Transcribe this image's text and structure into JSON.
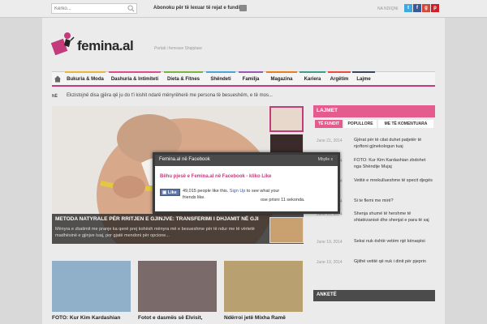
{
  "topbar": {
    "search_placeholder": "Kërko...",
    "subscribe_text": "Abonoku për të lexuar të rejat e fundit",
    "follow_label": "NA NDIQNI",
    "social": [
      {
        "name": "twitter-icon",
        "glyph": "t",
        "color": "#3fa9e0"
      },
      {
        "name": "facebook-icon",
        "glyph": "f",
        "color": "#3b5998"
      },
      {
        "name": "googleplus-icon",
        "glyph": "g",
        "color": "#d34836"
      },
      {
        "name": "pinterest-icon",
        "glyph": "p",
        "color": "#cb2027"
      }
    ]
  },
  "brand": {
    "logo": "femina.al",
    "tagline": "Portali i femrave Shqiptare",
    "accent": "#c43b7c"
  },
  "nav": {
    "items": [
      {
        "label": "Bukuria & Moda",
        "color": "#e8b63a"
      },
      {
        "label": "Dashuria & Intimiteti",
        "color": "#d94f8a"
      },
      {
        "label": "Dieta & Fitnes",
        "color": "#7bb43f"
      },
      {
        "label": "Shëndeti",
        "color": "#48a6d6"
      },
      {
        "label": "Familja",
        "color": "#9b59b6"
      },
      {
        "label": "Magazina",
        "color": "#e67e22"
      },
      {
        "label": "Kariera",
        "color": "#3b9c8f"
      },
      {
        "label": "Argëtim",
        "color": "#e74c3c"
      },
      {
        "label": "Lajme",
        "color": "#34495e"
      }
    ]
  },
  "ticker": {
    "label": "NË",
    "text": "Ekzistojnë disa gjëra që ju do t'i kishit ndarë mënyrëherë me persona të besueshëm, e të mos..."
  },
  "hero": {
    "title": "METODA NATYRALE PËR RRITJEN E GJINJVE: TRANSFERIMI I DHJAMIT NË GJI",
    "desc": "Mënyra e zbatimit me pranje ka qenë prej kohësh mënyra më e besueshme për të ndur me të vërtetë madhësinë e gjinjve tuaj, por gjatë mendoni për opcione..."
  },
  "cards": [
    {
      "title": "FOTO: Kur Kim Kardashian"
    },
    {
      "title": "Fotot e dasmës së Elvisit,"
    },
    {
      "title": "Ndërroi jetë Mixha Ramë"
    }
  ],
  "sidebar": {
    "header": "LAJMET",
    "tabs": [
      "TË FUNDIT",
      "POPULLORE",
      "ME TË KOMENTUARA"
    ],
    "news": [
      {
        "date": "June 21, 2014",
        "title": "Gjërat për të cilat duhet patjetër të njoftoni gjinekologun tuaj"
      },
      {
        "date": "June 21, 2014",
        "title": "FOTO: Kur Kim Kardashian zbdohet nga Shëndije Mujaj"
      },
      {
        "date": "June 20, 2014",
        "title": "Vetitë e mrekullueshme të specit djegës"
      },
      {
        "date": "June 20, 2014",
        "title": "Si te flemi me mirë?"
      },
      {
        "date": "June 20, 2014",
        "title": "Shenja shumë të hershme të shtatëzanisë dhe shenjat e para të saj"
      },
      {
        "date": "June 19, 2014",
        "title": "Seksi nuk është vetëm një kënaqësi"
      },
      {
        "date": "June 19, 2014",
        "title": "Gjithë vetitë që nuk i dinit për pjeprin"
      }
    ],
    "poll_header": "ANKETË"
  },
  "fb_popup": {
    "title": "Femina.al në Facebook",
    "close": "Mbylle x",
    "link": "Bëhu pjesë e Femina.al në Facebook - kliko Like",
    "like_btn": "Like",
    "count": "49,015 people like this.",
    "signup": "Sign Up",
    "count_rest": "to see what your friends like.",
    "autoclose": "ose prisni 11 sekonda."
  }
}
